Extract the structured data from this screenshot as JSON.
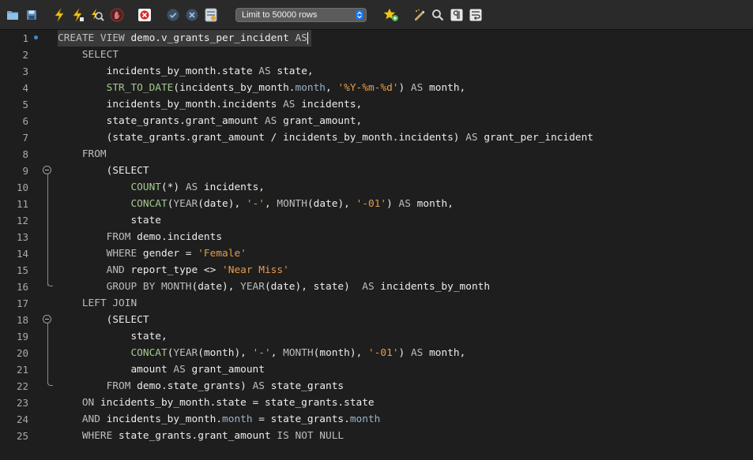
{
  "toolbar": {
    "limit_select": "Limit to 50000 rows",
    "icons": [
      "open-folder-icon",
      "save-icon",
      "execute-icon",
      "execute-current-icon",
      "explain-icon",
      "stop-icon",
      "toggle-error-icon",
      "commit-icon",
      "rollback-icon",
      "autocommit-icon",
      "add-snippet-icon",
      "beautify-icon",
      "find-icon",
      "invisibles-icon",
      "wrap-icon"
    ]
  },
  "editor": {
    "line_numbers": [
      "1",
      "2",
      "3",
      "4",
      "5",
      "6",
      "7",
      "8",
      "9",
      "10",
      "11",
      "12",
      "13",
      "14",
      "15",
      "16",
      "17",
      "18",
      "19",
      "20",
      "21",
      "22",
      "23",
      "24",
      "25"
    ],
    "lines": [
      [
        [
          "kw",
          "CREATE VIEW "
        ],
        [
          "id",
          "demo.v_grants_per_incident "
        ],
        [
          "kw",
          "AS"
        ]
      ],
      [
        [
          "kw",
          "    SELECT"
        ]
      ],
      [
        [
          "id",
          "        incidents_by_month.state "
        ],
        [
          "kw",
          "AS "
        ],
        [
          "id",
          "state,"
        ]
      ],
      [
        [
          "fn",
          "        STR_TO_DATE"
        ],
        [
          "id",
          "(incidents_by_month."
        ],
        [
          "col",
          "month"
        ],
        [
          "id",
          ", "
        ],
        [
          "str",
          "'%Y-%m-%d'"
        ],
        [
          "id",
          ") "
        ],
        [
          "kw",
          "AS "
        ],
        [
          "id",
          "month,"
        ]
      ],
      [
        [
          "id",
          "        incidents_by_month.incidents "
        ],
        [
          "kw",
          "AS "
        ],
        [
          "id",
          "incidents,"
        ]
      ],
      [
        [
          "id",
          "        state_grants.grant_amount "
        ],
        [
          "kw",
          "AS "
        ],
        [
          "id",
          "grant_amount,"
        ]
      ],
      [
        [
          "id",
          "        (state_grants.grant_amount / incidents_by_month.incidents) "
        ],
        [
          "kw",
          "AS "
        ],
        [
          "id",
          "grant_per_incident"
        ]
      ],
      [
        [
          "kw",
          "    FROM"
        ]
      ],
      [
        [
          "id",
          "        (SELECT"
        ]
      ],
      [
        [
          "fn",
          "            COUNT"
        ],
        [
          "id",
          "(*) "
        ],
        [
          "kw",
          "AS "
        ],
        [
          "id",
          "incidents,"
        ]
      ],
      [
        [
          "fn",
          "            CONCAT"
        ],
        [
          "id",
          "("
        ],
        [
          "kw",
          "YEAR"
        ],
        [
          "id",
          "(date), "
        ],
        [
          "str",
          "'-'"
        ],
        [
          "id",
          ", "
        ],
        [
          "kw",
          "MONTH"
        ],
        [
          "id",
          "(date), "
        ],
        [
          "str",
          "'-01'"
        ],
        [
          "id",
          ") "
        ],
        [
          "kw",
          "AS "
        ],
        [
          "id",
          "month,"
        ]
      ],
      [
        [
          "id",
          "            state"
        ]
      ],
      [
        [
          "kw",
          "        FROM "
        ],
        [
          "id",
          "demo.incidents"
        ]
      ],
      [
        [
          "kw",
          "        WHERE "
        ],
        [
          "id",
          "gender = "
        ],
        [
          "str",
          "'Female'"
        ]
      ],
      [
        [
          "kw",
          "        AND "
        ],
        [
          "id",
          "report_type <> "
        ],
        [
          "str",
          "'Near Miss'"
        ]
      ],
      [
        [
          "kw",
          "        GROUP BY MONTH"
        ],
        [
          "id",
          "(date), "
        ],
        [
          "kw",
          "YEAR"
        ],
        [
          "id",
          "(date), state)  "
        ],
        [
          "kw",
          "AS "
        ],
        [
          "id",
          "incidents_by_month"
        ]
      ],
      [
        [
          "kw",
          "    LEFT JOIN"
        ]
      ],
      [
        [
          "id",
          "        (SELECT"
        ]
      ],
      [
        [
          "id",
          "            state,"
        ]
      ],
      [
        [
          "fn",
          "            CONCAT"
        ],
        [
          "id",
          "("
        ],
        [
          "kw",
          "YEAR"
        ],
        [
          "id",
          "(month), "
        ],
        [
          "str",
          "'-'"
        ],
        [
          "id",
          ", "
        ],
        [
          "kw",
          "MONTH"
        ],
        [
          "id",
          "(month), "
        ],
        [
          "str",
          "'-01'"
        ],
        [
          "id",
          ") "
        ],
        [
          "kw",
          "AS "
        ],
        [
          "id",
          "month,"
        ]
      ],
      [
        [
          "id",
          "            amount "
        ],
        [
          "kw",
          "AS "
        ],
        [
          "id",
          "grant_amount"
        ]
      ],
      [
        [
          "kw",
          "        FROM "
        ],
        [
          "id",
          "demo.state_grants) "
        ],
        [
          "kw",
          "AS "
        ],
        [
          "id",
          "state_grants"
        ]
      ],
      [
        [
          "kw",
          "    ON "
        ],
        [
          "id",
          "incidents_by_month.state = state_grants.state"
        ]
      ],
      [
        [
          "kw",
          "    AND "
        ],
        [
          "id",
          "incidents_by_month."
        ],
        [
          "col",
          "month"
        ],
        [
          "id",
          " = state_grants."
        ],
        [
          "col",
          "month"
        ]
      ],
      [
        [
          "kw",
          "    WHERE "
        ],
        [
          "id",
          "state_grants.grant_amount "
        ],
        [
          "kw",
          "IS NOT NULL"
        ]
      ]
    ]
  }
}
